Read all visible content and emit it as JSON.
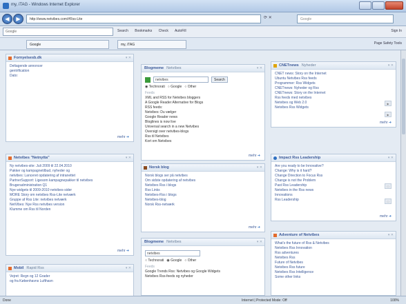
{
  "window": {
    "title": "my, iTAG - Windows Internet Explorer"
  },
  "address": {
    "url": "http://www.netvibes.com/#Rss-Lite",
    "search_placeholder": "Google"
  },
  "google_bar": {
    "search": "Google",
    "items": [
      "Search",
      "Bookmarks",
      "Check",
      "AutoFill",
      "Sign In"
    ]
  },
  "tabs": {
    "left": "Google",
    "right": "my, iTAG",
    "tools": "Page  Safety  Tools"
  },
  "widgets": {
    "w1": {
      "title": "Fornyelsesb.dk",
      "more": "mehr",
      "items": [
        "Deltagende annoncer",
        "gentrification",
        "Dato: "
      ]
    },
    "w2": {
      "title": "Netvibes \"Netnytta\"",
      "more": "mehr",
      "items": [
        "Ny netvibes-site: Juli 2009 til 22.04.2010",
        "Pakker og kampagnetilbud, nyheder og",
        "netvibes: Lanceret opdatering af intranettet",
        "PartnerSupport: Ligesom kampagnepakker til netvibes",
        "Brugeradministration Q1",
        "Nye widgets til 2009-2010 netvibes-sider",
        "MORE Story om netvibes Rss-Lite netværk",
        "Gruppe af Rss Lite: netvibes netværk",
        "NetVibes: Nye Rss netvibes version",
        "Klumme om Rss til Norden"
      ]
    },
    "w3": {
      "title": "Mobil",
      "extra": "Rapid Rss",
      "more": "mehr",
      "items": [
        "Vejret: Regn og 12 Grader",
        "og fra Københavns Lufthavn"
      ]
    },
    "w4": {
      "title": "Blogmeme",
      "extra": "Netvibes",
      "more": "mehr",
      "input": "netvibes",
      "button": "Search",
      "radios": [
        "Technorati",
        "Google",
        "Other"
      ],
      "section": "Feeds",
      "items": [
        "XML and RSS for Netvibes bloggers",
        "A Google Reader Alternative for Blogs",
        "RSS feeds: ",
        "Netvibes: Du vælger",
        "Google Reader news",
        "Bloglines is now live",
        "Universal search in a new Netvibes",
        "Oversigt over netvibes-blogs",
        "Rss til Netvibes",
        "Kort om Netvibes"
      ]
    },
    "w5": {
      "title": "Norsk blog",
      "more": "mehr",
      "items": [
        "Norsk blogs ser på netvibes",
        "Om sidste opdatering af netvibes",
        "Netvibes Rss i blogs",
        "Rss Links ",
        "Netvibes-Rss i blogs",
        "Netvibes-blog",
        "Norsk Rss-netværk"
      ]
    },
    "w6": {
      "title": "Blogmeme",
      "extra": "Netvibes",
      "more": "mehr",
      "input": "netvibes",
      "radios": [
        "Technorati",
        "Google",
        "Other"
      ],
      "section": "Feeds",
      "items": [
        "Google Trends Rss: Netvibes og Google Widgets",
        "Netvibes Rss-feeds og nyheder"
      ]
    },
    "w7": {
      "title": "CNETnews",
      "extra": "Nyheder",
      "more": "mehr",
      "items": [
        "CNET news: Story on the Internet",
        "Ubuntu Netvibes Rss feeds",
        "Programmer: Rss Widgets",
        "CNETnews: Nyheder og Rss",
        "CNETnews: Story on the Internet",
        "Rss feeds med netvibes",
        "Netvibes og Web 2.0",
        "Netvibes Rss Widgets"
      ]
    },
    "w8": {
      "title": "Impact Rss Leadership",
      "more": "mehr",
      "items": [
        "Are you ready to be Innovative?",
        "Change: Why is it hard?",
        "Change Direction to Focus Rss",
        "Change is not the Problem",
        "Past Rss Leadership",
        "Netvibes in the Rss news",
        "Innovations",
        "Rss Leadership"
      ]
    },
    "w9": {
      "title": "Adventure of Netvibes",
      "more": "mehr",
      "items": [
        "What's the future of Rss & Netvibes",
        "Netvibes Rss Innovation",
        "Rss adventures",
        "Netvibes Rss",
        "Future of Netvibes",
        "Netvibes Rss future",
        "Netvibes Rss Intelligence",
        "Some other links"
      ]
    }
  },
  "status": {
    "left": "Done",
    "zone": "Internet | Protected Mode: Off",
    "zoom": "100%"
  },
  "colors": {
    "accent": "#3b5998",
    "chrome": "#cfdded"
  }
}
